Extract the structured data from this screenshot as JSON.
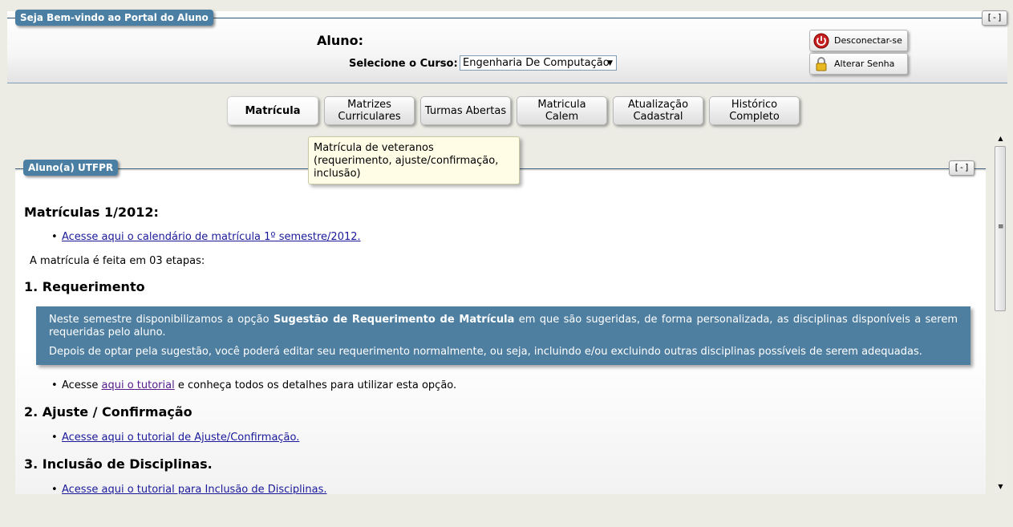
{
  "header": {
    "legend": "Seja Bem-vindo ao Portal do Aluno",
    "collapse": "[-]",
    "aluno_label": "Aluno:",
    "curso_label": "Selecione o Curso:",
    "curso_selected": "Engenharia De Computação",
    "disconnect": "Desconectar-se",
    "change_password": "Alterar Senha"
  },
  "tabs": [
    {
      "label": "Matrícula",
      "active": true
    },
    {
      "label": "Matrizes Curriculares"
    },
    {
      "label": "Turmas Abertas"
    },
    {
      "label": "Matricula Calem"
    },
    {
      "label": "Atualização Cadastral"
    },
    {
      "label": "Histórico Completo"
    }
  ],
  "tooltip": "Matrícula de veteranos (requerimento, ajuste/confirmação, inclusão)",
  "content": {
    "legend": "Aluno(a) UTFPR",
    "collapse": "[-]",
    "title": "Matrículas 1/2012:",
    "calendar_link": "Acesse aqui o calendário de matrícula 1º semestre/2012.",
    "steps_text": "A matrícula é feita em 03 etapas:",
    "step1_title": "1. Requerimento",
    "info_p1_pre": "Neste semestre disponibilizamos a opção ",
    "info_p1_bold": "Sugestão de Requerimento de Matrícula",
    "info_p1_post": " em que são sugeridas, de forma personalizada, as disciplinas disponíveis a serem requeridas pelo aluno.",
    "info_p2": "Depois de optar pela sugestão, você poderá editar seu requerimento normalmente, ou seja, incluindo e/ou excluindo outras disciplinas possíveis de serem adequadas.",
    "tutorial_pre": "Acesse ",
    "tutorial_link": "aqui o tutorial",
    "tutorial_post": " e conheça todos os detalhes para utilizar esta opção.",
    "step2_title": "2. Ajuste / Confirmação",
    "step2_link": "Acesse aqui o tutorial de Ajuste/Confirmação.",
    "step3_title": "3. Inclusão de Disciplinas.",
    "step3_link": "Acesse aqui o tutorial para Inclusão de Disciplinas."
  },
  "icons": {
    "disconnect": "power-icon",
    "change_password": "padlock-icon",
    "scroll_up": "arrow-up-icon",
    "scroll_down": "arrow-down-icon"
  },
  "colors": {
    "legend_bg": "#4a7fa3",
    "info_box_bg": "#4e7fa1",
    "link": "#1a1a99",
    "visited_link": "#551a8b"
  }
}
